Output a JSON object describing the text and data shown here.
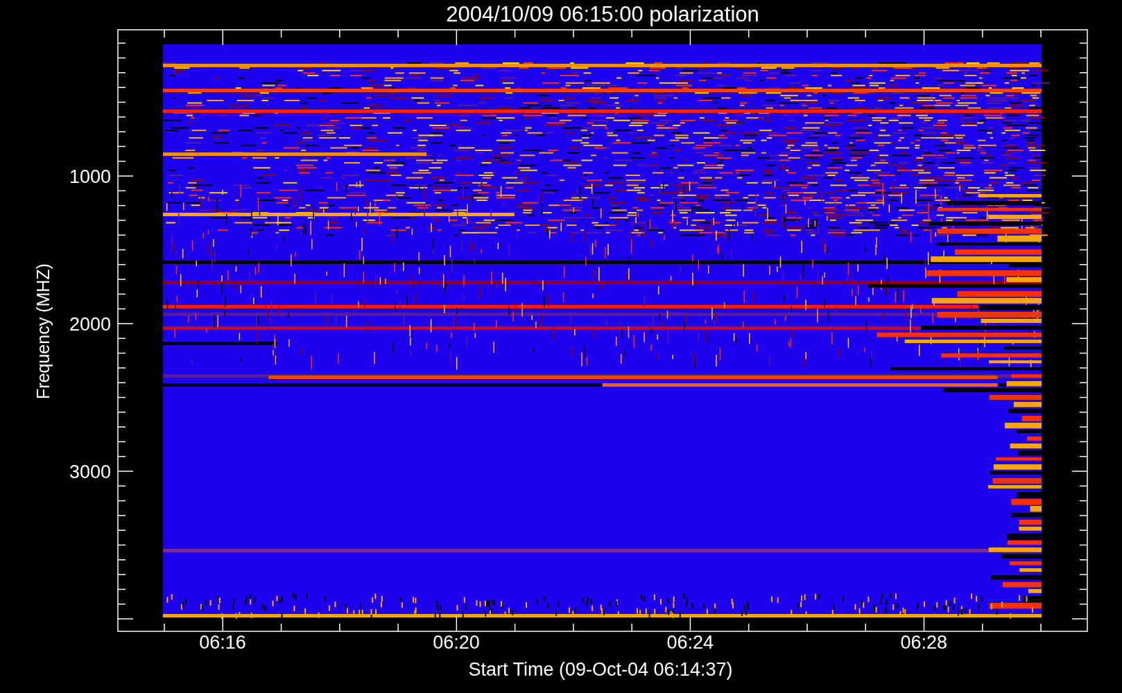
{
  "title": "2004/10/09 06:15:00 polarization",
  "y_axis": {
    "label": "Frequency (MHZ)",
    "tick_labels": [
      "1000",
      "2000",
      "3000"
    ]
  },
  "x_axis": {
    "label": "Start Time (09-Oct-04 06:14:37)",
    "tick_labels": [
      "06:16",
      "06:20",
      "06:24",
      "06:28"
    ]
  }
}
